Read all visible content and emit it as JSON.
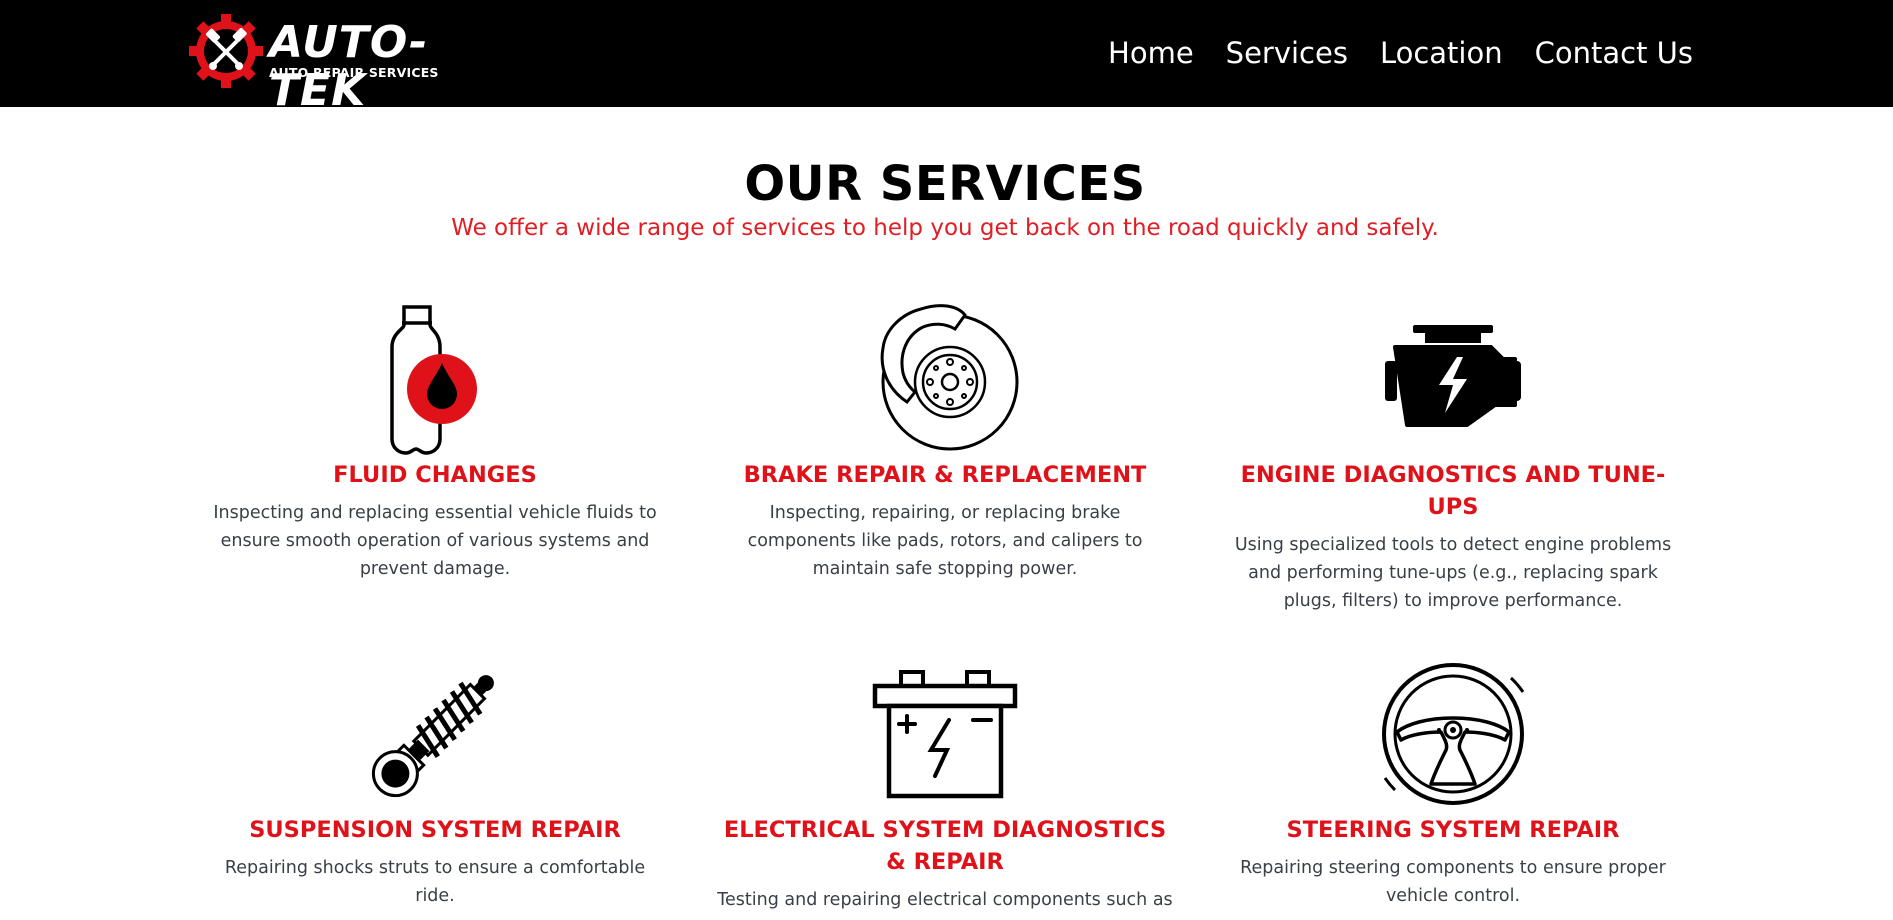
{
  "brand": {
    "name": "AUTO-TEK",
    "tagline": "AUTO REPAIR SERVICES"
  },
  "nav": {
    "items": [
      "Home",
      "Services",
      "Location",
      "Contact Us"
    ]
  },
  "page": {
    "title": "OUR SERVICES",
    "subtitle": "We offer a wide range of services to help you get back on the road quickly and safely."
  },
  "services": [
    {
      "icon": "fluid-bottle-icon",
      "title": "FLUID CHANGES",
      "description": "Inspecting and replacing essential vehicle fluids to ensure smooth operation of various systems and prevent damage."
    },
    {
      "icon": "brake-disc-icon",
      "title": "BRAKE REPAIR & REPLACEMENT",
      "description": "Inspecting, repairing, or replacing brake components like pads, rotors, and calipers to maintain safe stopping power."
    },
    {
      "icon": "engine-icon",
      "title": "ENGINE DIAGNOSTICS AND TUNE-UPS",
      "description": "Using specialized tools to detect engine problems and performing tune-ups (e.g., replacing spark plugs, filters) to improve performance."
    },
    {
      "icon": "shock-absorber-icon",
      "title": "SUSPENSION SYSTEM REPAIR",
      "description": "Repairing shocks struts to ensure a comfortable ride."
    },
    {
      "icon": "car-battery-icon",
      "title": "ELECTRICAL SYSTEM DIAGNOSTICS & REPAIR",
      "description": "Testing and repairing electrical components such as"
    },
    {
      "icon": "steering-wheel-icon",
      "title": "STEERING SYSTEM REPAIR",
      "description": "Repairing steering components to ensure proper vehicle control."
    }
  ],
  "colors": {
    "accent": "#e01219",
    "header_bg": "#000000",
    "body_text": "#3a3f47"
  }
}
